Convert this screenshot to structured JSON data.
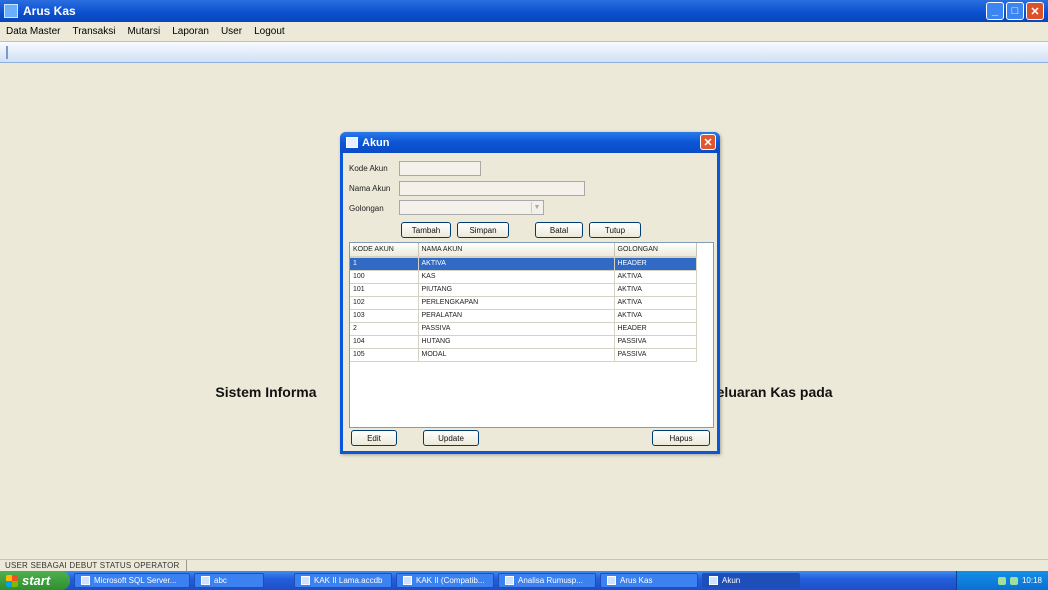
{
  "app": {
    "title": "Arus Kas"
  },
  "menu": [
    "Data Master",
    "Transaksi",
    "Mutarsi",
    "Laporan",
    "User",
    "Logout"
  ],
  "main": {
    "heading_left": "Sistem Informa",
    "heading_right": "ngeluaran Kas pada"
  },
  "dialog": {
    "title": "Akun",
    "fields": {
      "kode_label": "Kode Akun",
      "kode_value": "",
      "nama_label": "Nama Akun",
      "nama_value": "",
      "golongan_label": "Golongan",
      "golongan_value": ""
    },
    "buttons": {
      "tambah": "Tambah",
      "simpan": "Simpan",
      "batal": "Batal",
      "tutup": "Tutup",
      "edit": "Edit",
      "update": "Update",
      "hapus": "Hapus"
    },
    "table": {
      "columns": [
        "KODE AKUN",
        "NAMA AKUN",
        "GOLONGAN"
      ],
      "rows": [
        [
          "1",
          "AKTIVA",
          "HEADER"
        ],
        [
          "100",
          "KAS",
          "AKTIVA"
        ],
        [
          "101",
          "PIUTANG",
          "AKTIVA"
        ],
        [
          "102",
          "PERLENGKAPAN",
          "AKTIVA"
        ],
        [
          "103",
          "PERALATAN",
          "AKTIVA"
        ],
        [
          "2",
          "PASSIVA",
          "HEADER"
        ],
        [
          "104",
          "HUTANG",
          "PASSIVA"
        ],
        [
          "105",
          "MODAL",
          "PASSIVA"
        ]
      ],
      "selected_row": 0
    }
  },
  "statusbar": {
    "text": "USER SEBAGAI DEBUT   STATUS OPERATOR"
  },
  "taskbar": {
    "start_label": "start",
    "tasks": [
      "Microsoft SQL Server...",
      "abc",
      "KAK II Lama.accdb",
      "KAK II (Compatib...",
      "Analisa Rumusp...",
      "Arus Kas",
      "Akun"
    ],
    "active_task": 6,
    "clock": "10:18"
  },
  "colors": {
    "titlebar": "#0a4fcf",
    "selection": "#316ac5",
    "window_bg": "#ece9d8"
  }
}
